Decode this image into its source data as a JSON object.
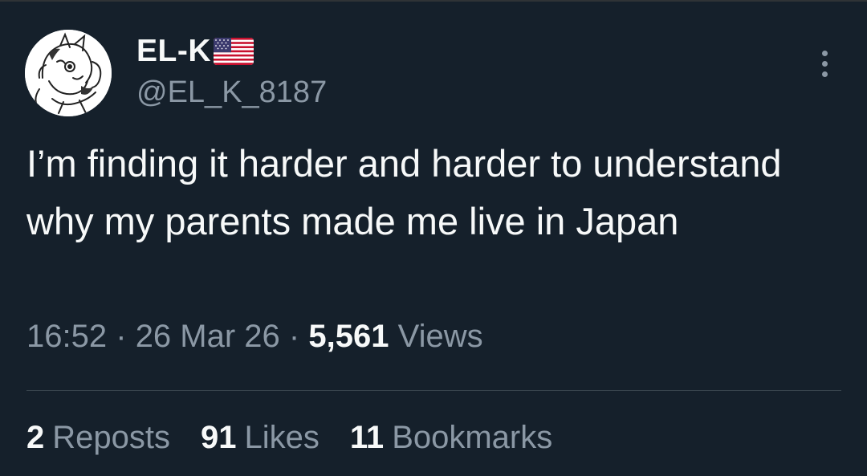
{
  "user": {
    "display_name": "EL-K",
    "badge_icon": "us-flag-icon",
    "handle": "@EL_K_8187"
  },
  "tweet": {
    "text": "I’m finding it harder and harder to understand why my parents made me live in Japan",
    "time": "16:52",
    "date": "26 Mar 26",
    "views_count": "5,561",
    "views_label": "Views",
    "separator": "·"
  },
  "stats": {
    "reposts": {
      "count": "2",
      "label": "Reposts"
    },
    "likes": {
      "count": "91",
      "label": "Likes"
    },
    "bookmarks": {
      "count": "11",
      "label": "Bookmarks"
    }
  },
  "colors": {
    "background": "#15202b",
    "primary_text": "#f7f9f9",
    "secondary_text": "#8b98a5",
    "divider": "#38444d"
  }
}
